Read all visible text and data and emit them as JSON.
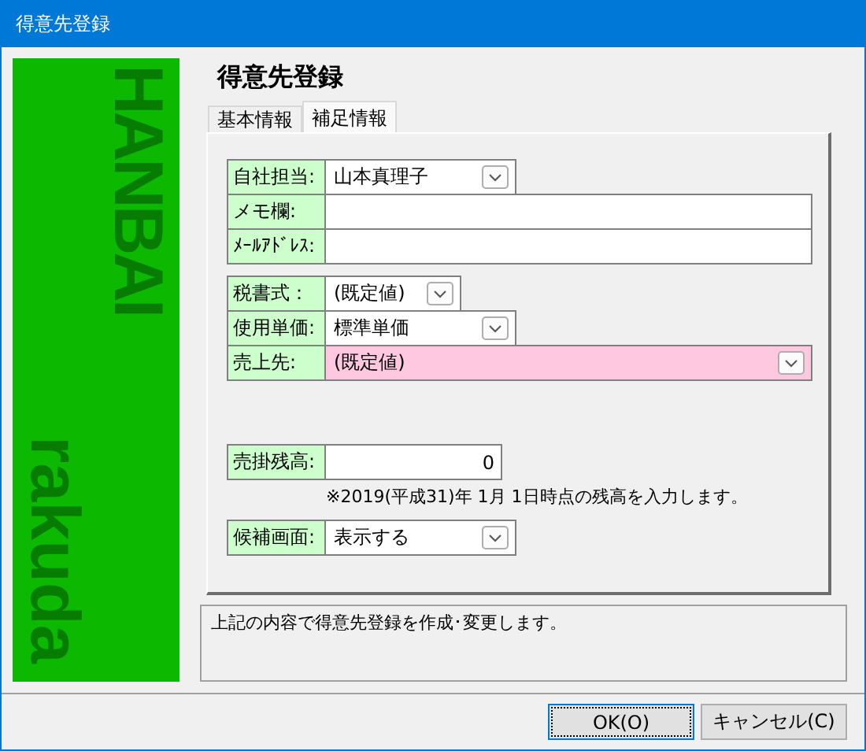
{
  "window": {
    "title": "得意先登録"
  },
  "banner": {
    "texts": [
      "HANBAI",
      "rakuda"
    ]
  },
  "heading": "得意先登録",
  "tabs": [
    {
      "label": "基本情報",
      "selected": false
    },
    {
      "label": "補足情報",
      "selected": true
    }
  ],
  "groups": [
    {
      "fields": [
        {
          "label": "自社担当:",
          "kind": "dropdown",
          "value": "山本真理子",
          "highlighted": false
        },
        {
          "label": "メモ欄:",
          "kind": "text",
          "highlighted": false
        },
        {
          "label": "ﾒｰﾙｱﾄﾞﾚｽ:",
          "kind": "text",
          "highlighted": false
        }
      ]
    },
    {
      "fields": [
        {
          "label": "税書式：",
          "kind": "dropdown",
          "value": "(既定値)",
          "highlighted": false
        },
        {
          "label": "使用単価:",
          "kind": "dropdown",
          "value": "標準単価",
          "highlighted": false
        },
        {
          "label": "売上先:",
          "kind": "dropdown",
          "value": "(既定値)",
          "highlighted": true
        }
      ]
    },
    {
      "fields": [
        {
          "label": "売掛残高:",
          "kind": "number",
          "value": "0",
          "highlighted": false,
          "note": "※2019(平成31)年 1月 1日時点の残高を入力します。"
        }
      ]
    },
    {
      "fields": [
        {
          "label": "候補画面:",
          "kind": "dropdown",
          "value": "表示する",
          "highlighted": false
        }
      ]
    }
  ],
  "message": "上記の内容で得意先登録を作成･変更します。",
  "buttons": [
    {
      "label": "OK(O)",
      "default": true
    },
    {
      "label": "キャンセル(C)",
      "default": false
    }
  ]
}
